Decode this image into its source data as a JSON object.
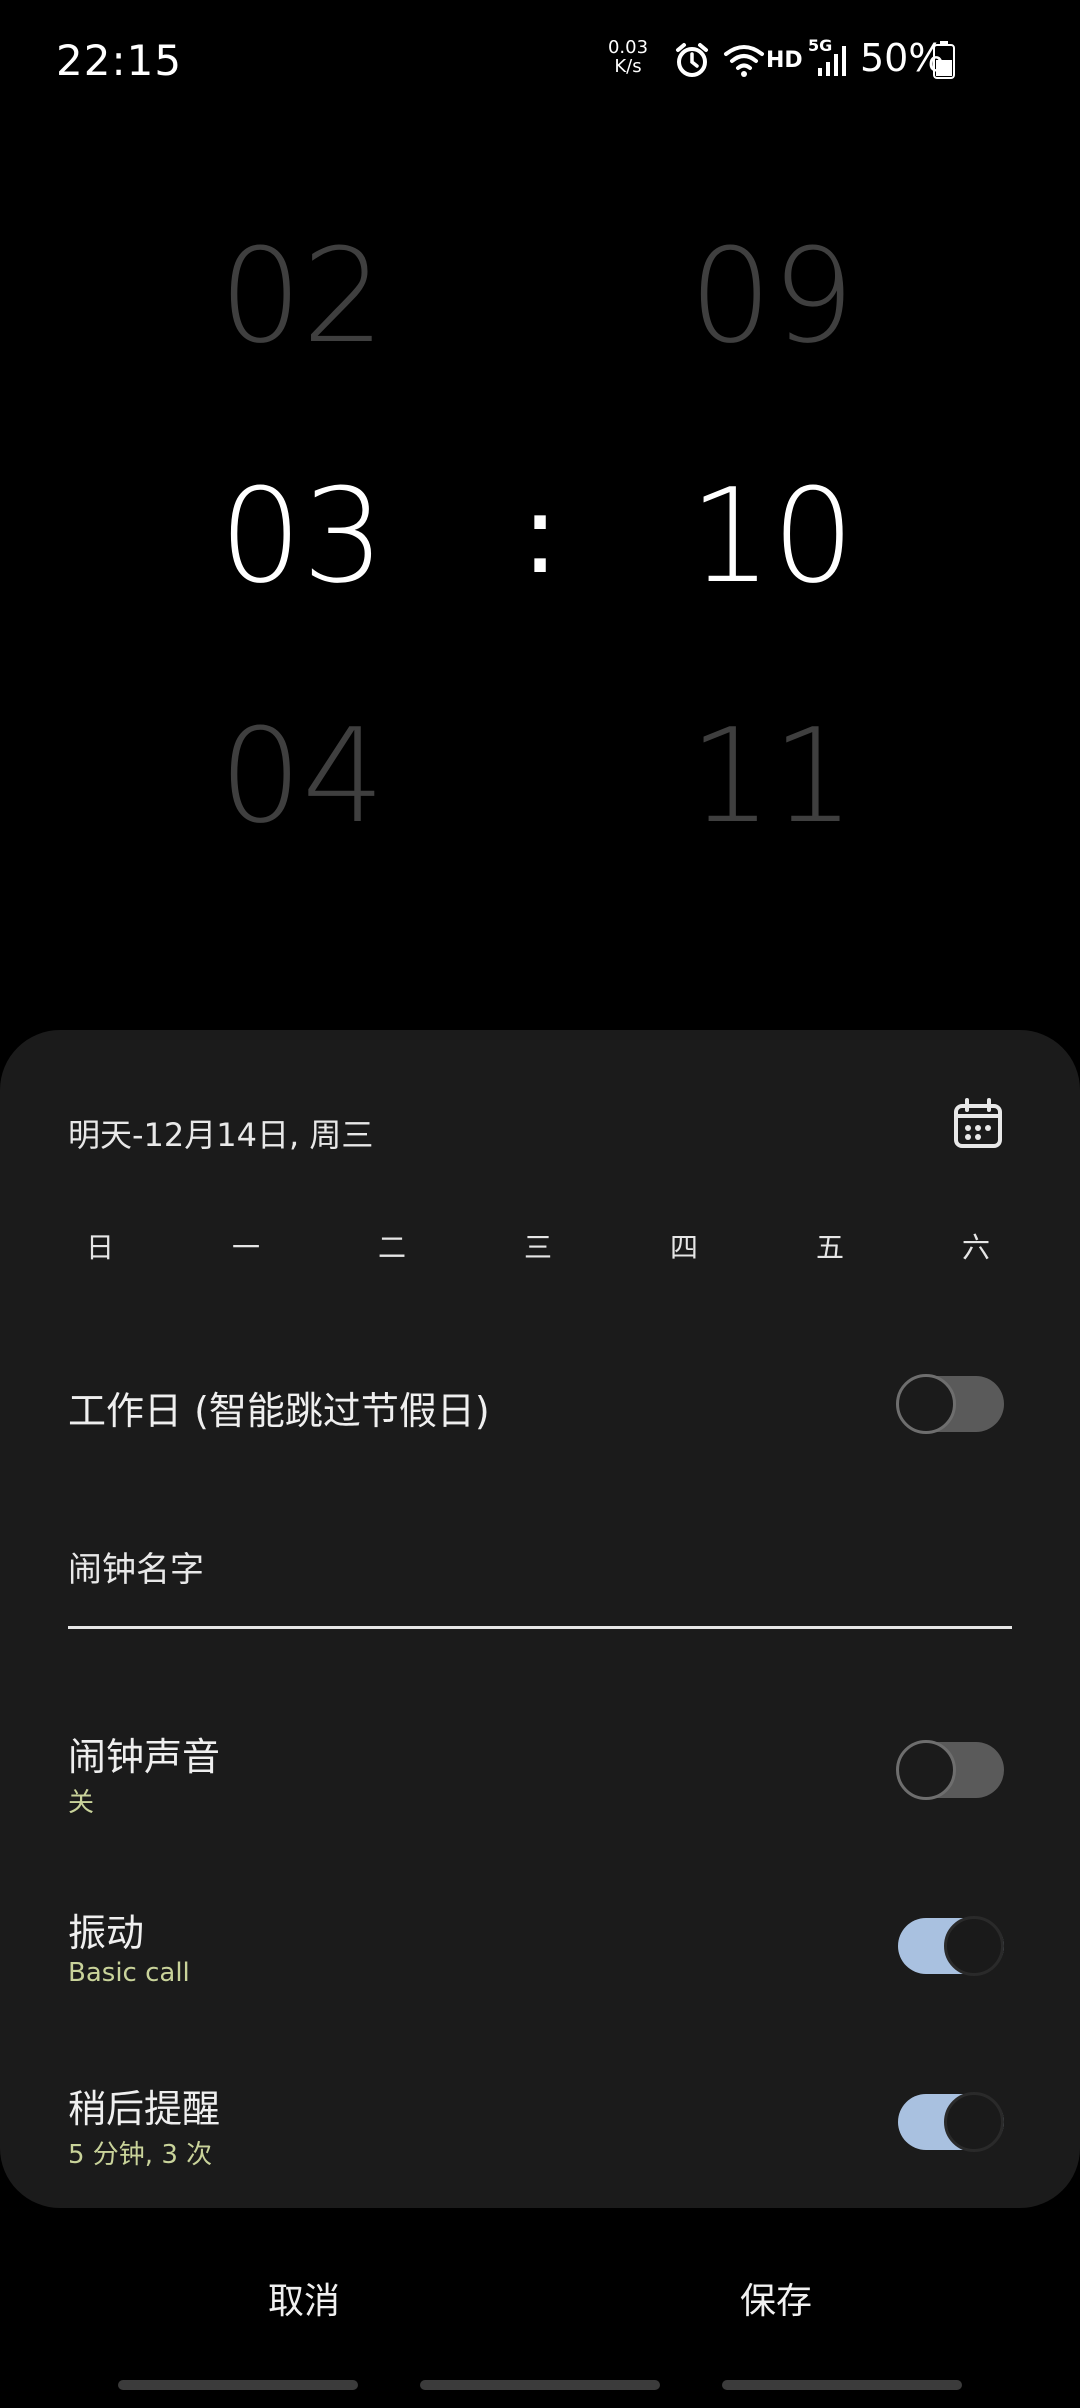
{
  "status_bar": {
    "time": "22:15",
    "net_speed_value": "0.03",
    "net_speed_unit": "K/s",
    "hd_label": "HD",
    "network": "5G",
    "battery": "50%"
  },
  "picker": {
    "hours": {
      "prev": "02",
      "current": "03",
      "next": "04"
    },
    "separator": ":",
    "minutes": {
      "prev": "09",
      "current": "10",
      "next": "11"
    }
  },
  "sheet": {
    "date_label": "明天-12月14日, 周三",
    "weekdays": [
      "日",
      "一",
      "二",
      "三",
      "四",
      "五",
      "六"
    ],
    "workday": {
      "label": "工作日 (智能跳过节假日)",
      "on": false
    },
    "alarm_name": {
      "placeholder": "闹钟名字",
      "value": ""
    },
    "alarm_sound": {
      "title": "闹钟声音",
      "sub": "关",
      "on": false
    },
    "vibration": {
      "title": "振动",
      "sub": "Basic call",
      "on": true
    },
    "snooze": {
      "title": "稍后提醒",
      "sub": "5 分钟, 3 次",
      "on": true
    }
  },
  "actions": {
    "cancel": "取消",
    "save": "保存"
  },
  "colors": {
    "sheet_bg": "#1b1b1b",
    "toggle_on": "#a9c1e0",
    "toggle_off": "#5a5a5a",
    "subtext": "#c9d39a"
  }
}
